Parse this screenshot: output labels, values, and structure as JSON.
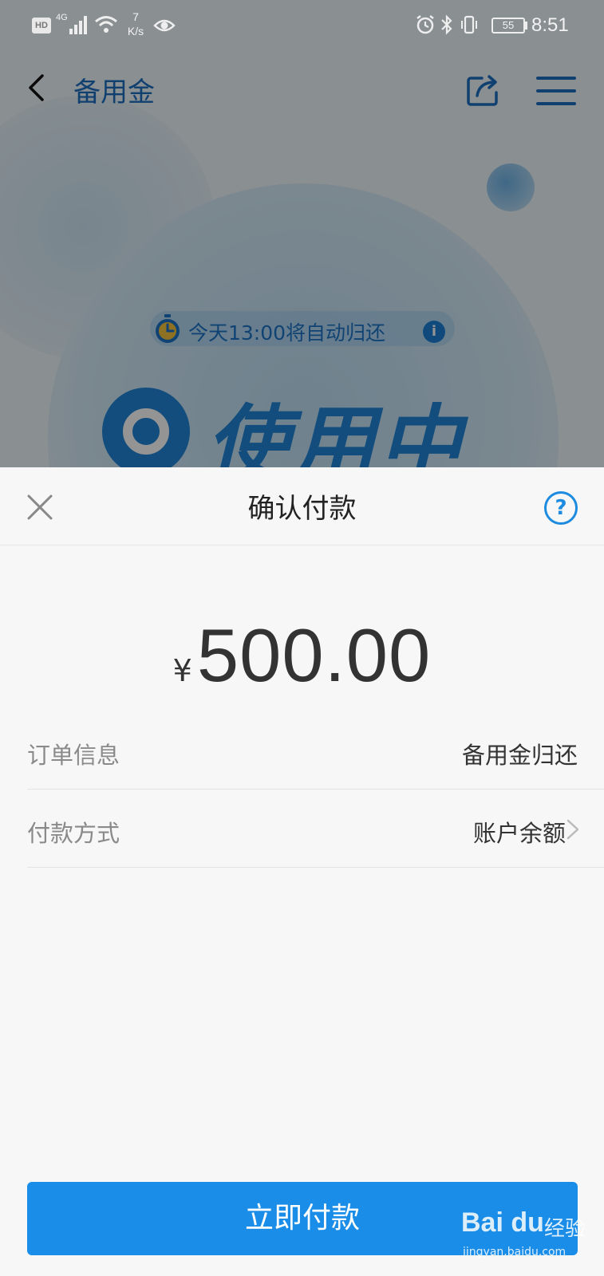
{
  "status_bar": {
    "hd": "HD",
    "network": "4G",
    "speed_value": "7",
    "speed_unit": "K/s",
    "battery": "55",
    "time": "8:51"
  },
  "background_page": {
    "title": "备用金",
    "timer_text": "今天13:00将自动归还",
    "status_text": "使用中"
  },
  "sheet": {
    "title": "确认付款",
    "amount_currency": "¥",
    "amount": "500.00",
    "order_label": "订单信息",
    "order_value": "备用金归还",
    "payment_label": "付款方式",
    "payment_value": "账户余额",
    "pay_button": "立即付款"
  },
  "watermark": {
    "logo": "Bai du",
    "suffix": "经验",
    "url": "jingyan.baidu.com"
  },
  "colors": {
    "accent": "#1a8de8",
    "bg_title": "#1c6fc2",
    "sheet_bg": "#f7f7f7"
  }
}
